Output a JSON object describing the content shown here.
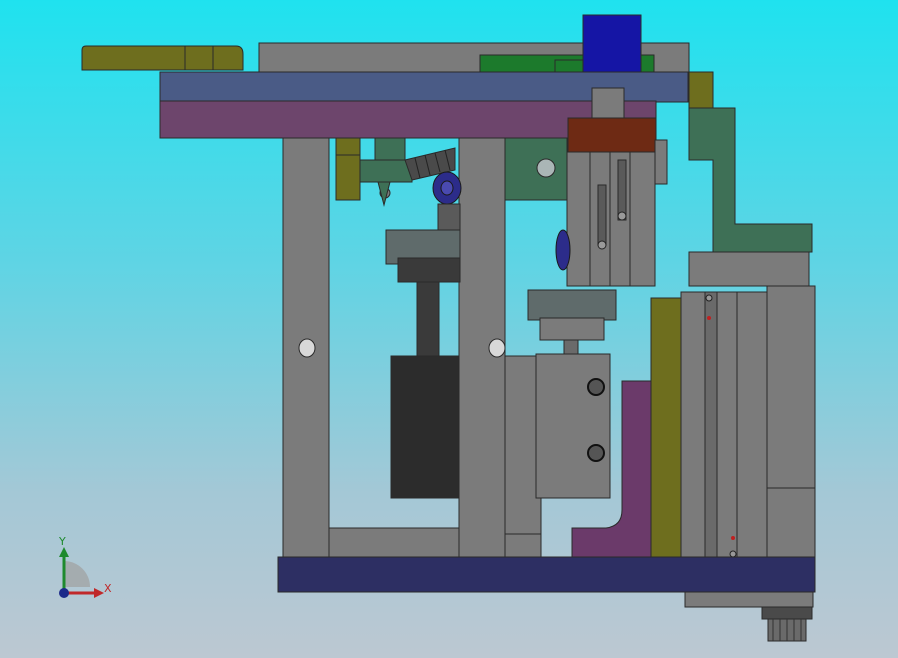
{
  "viewport": {
    "background_top": "#1fe2ef",
    "background_bottom": "#bcc8d2"
  },
  "model": {
    "part_colors": {
      "frame_gray": "#7b7b7b",
      "frame_dark": "#5a5a5a",
      "top_plate_blue": "#4a5b86",
      "top_plate_purple": "#6d456c",
      "base_plate_navy": "#2d2f63",
      "olive": "#6e6e1e",
      "green_bracket": "#3e7056",
      "bright_green": "#1c7a2c",
      "blue_block": "#1515a5",
      "brown_block": "#6e2a14",
      "magenta_bracket": "#6b3a6a",
      "motor_black": "#2c2c2c"
    }
  },
  "triad": {
    "x_label": "X",
    "y_label": "Y",
    "x_color": "#c0282a",
    "y_color": "#1e8a2e",
    "origin_color": "#1c2a8a"
  }
}
